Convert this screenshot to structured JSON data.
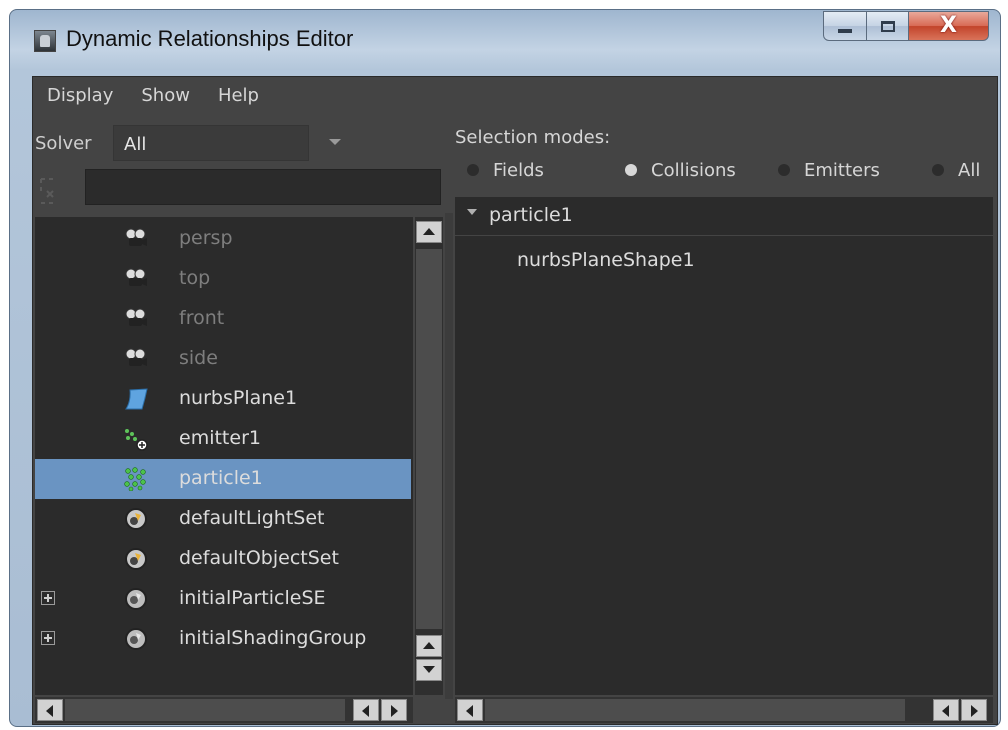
{
  "window": {
    "title": "Dynamic Relationships Editor",
    "controls": {
      "minimize": "minimize",
      "maximize": "maximize",
      "close": "X"
    }
  },
  "menu": [
    "Display",
    "Show",
    "Help"
  ],
  "solver": {
    "label": "Solver",
    "value": "All"
  },
  "selection_modes": {
    "label": "Selection modes:",
    "options": [
      {
        "label": "Fields",
        "selected": false
      },
      {
        "label": "Collisions",
        "selected": true
      },
      {
        "label": "Emitters",
        "selected": false
      },
      {
        "label": "All",
        "selected": false
      }
    ]
  },
  "outliner": {
    "items": [
      {
        "label": "persp",
        "icon": "camera-icon",
        "dimmed": true,
        "selected": false,
        "expandable": false
      },
      {
        "label": "top",
        "icon": "camera-icon",
        "dimmed": true,
        "selected": false,
        "expandable": false
      },
      {
        "label": "front",
        "icon": "camera-icon",
        "dimmed": true,
        "selected": false,
        "expandable": false
      },
      {
        "label": "side",
        "icon": "camera-icon",
        "dimmed": true,
        "selected": false,
        "expandable": false
      },
      {
        "label": "nurbsPlane1",
        "icon": "nurbs-plane-icon",
        "dimmed": false,
        "selected": false,
        "expandable": false
      },
      {
        "label": "emitter1",
        "icon": "emitter-icon",
        "dimmed": false,
        "selected": false,
        "expandable": false
      },
      {
        "label": "particle1",
        "icon": "particle-icon",
        "dimmed": false,
        "selected": true,
        "expandable": false
      },
      {
        "label": "defaultLightSet",
        "icon": "set-icon",
        "dimmed": false,
        "selected": false,
        "expandable": false
      },
      {
        "label": "defaultObjectSet",
        "icon": "set-icon",
        "dimmed": false,
        "selected": false,
        "expandable": false
      },
      {
        "label": "initialParticleSE",
        "icon": "shading-group-icon",
        "dimmed": false,
        "selected": false,
        "expandable": true
      },
      {
        "label": "initialShadingGroup",
        "icon": "shading-group-icon",
        "dimmed": false,
        "selected": false,
        "expandable": true
      }
    ]
  },
  "relationships": {
    "parent": "particle1",
    "children": [
      "nurbsPlaneShape1"
    ]
  },
  "colors": {
    "background": "#444444",
    "panel": "#2b2b2b",
    "selection": "#6a94c2",
    "text": "#dcdcdc",
    "dim_text": "#7e7e7e"
  }
}
